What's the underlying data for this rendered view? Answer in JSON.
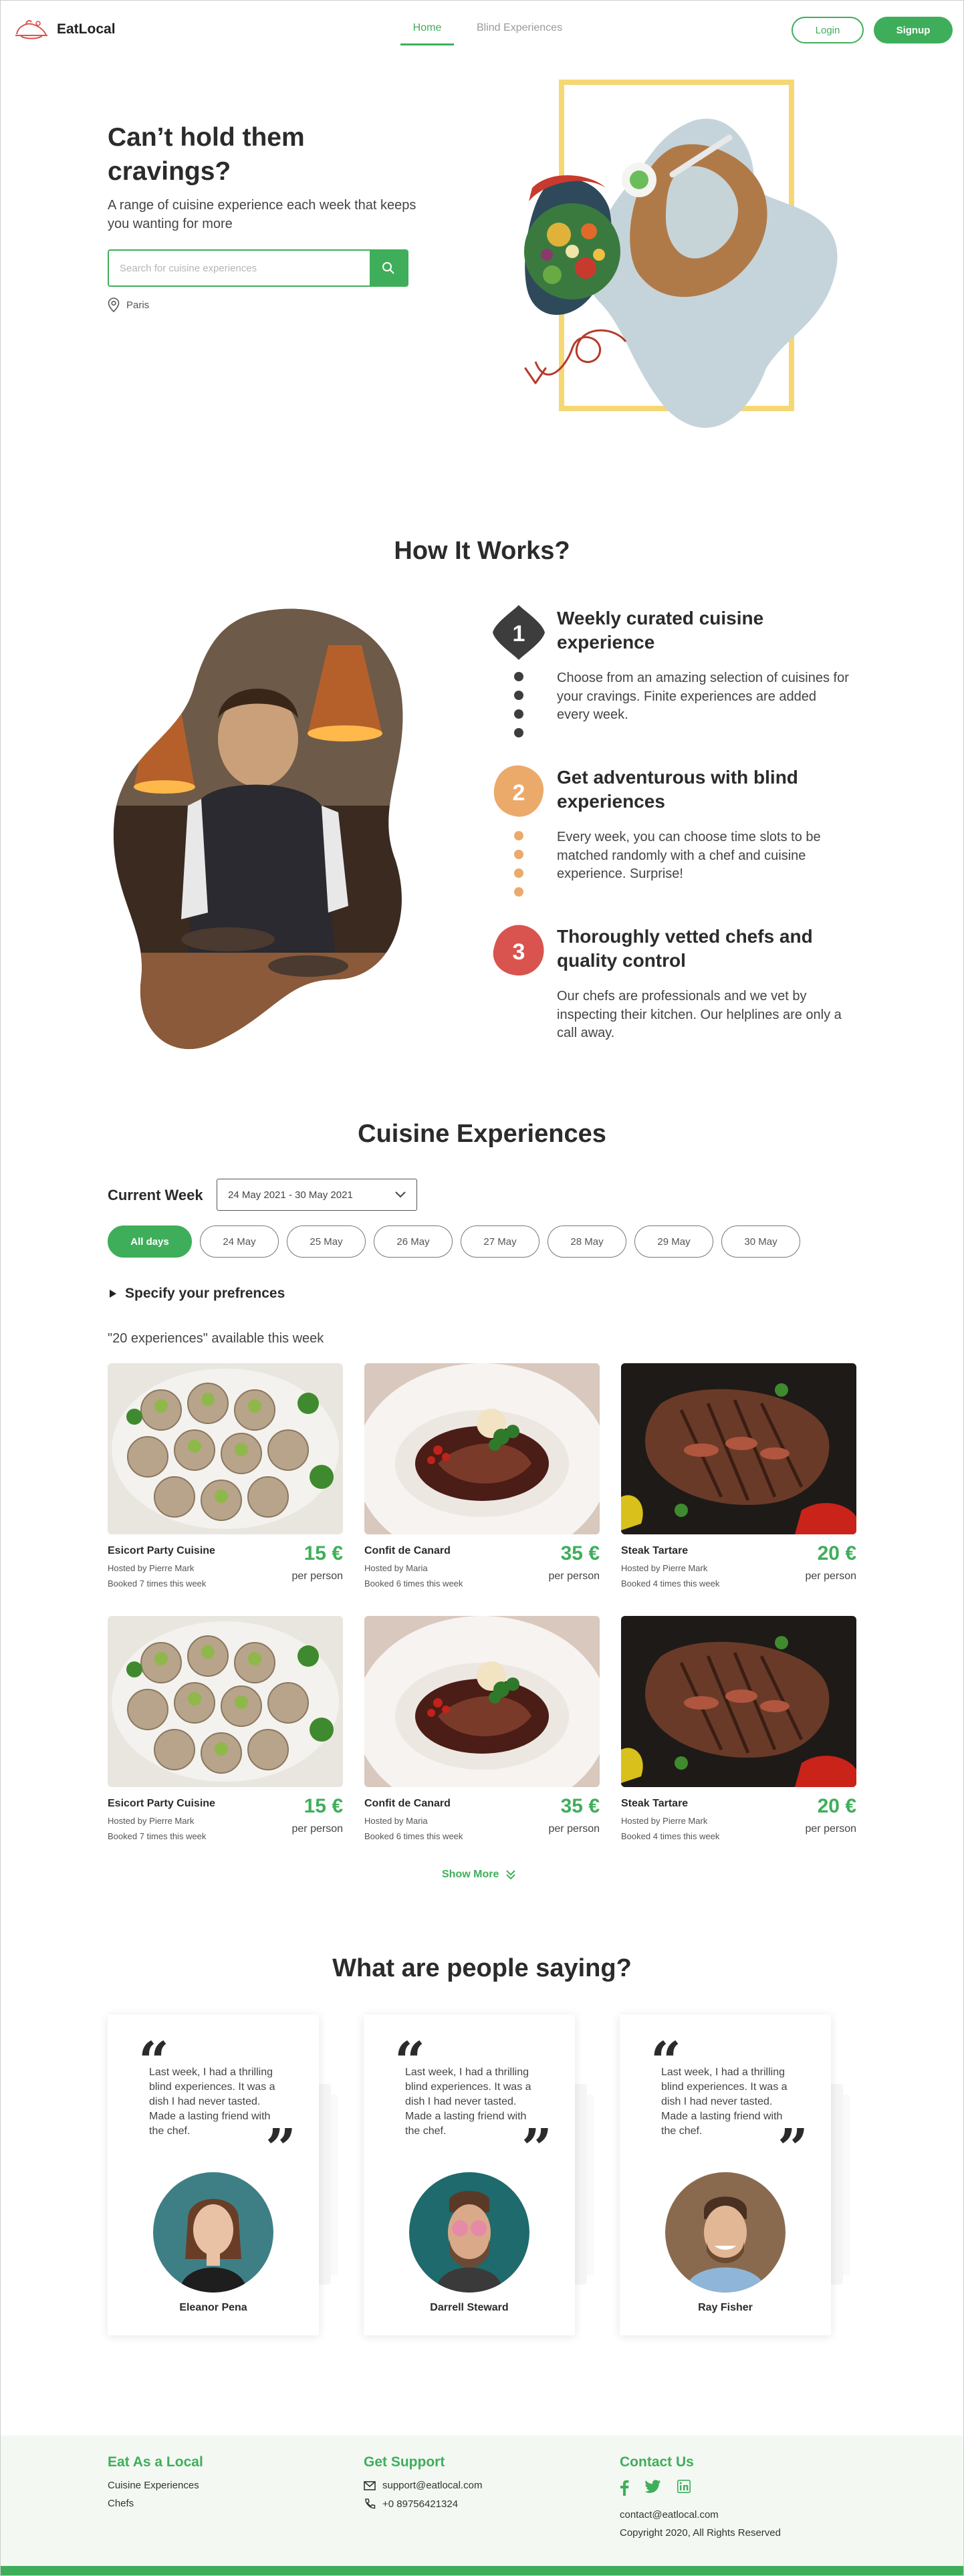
{
  "brand": {
    "name": "EatLocal",
    "accent": "#3fae5a"
  },
  "header": {
    "nav": [
      "Home",
      "Blind Experiences"
    ],
    "login": "Login",
    "signup": "Signup"
  },
  "hero": {
    "title": "Can’t hold them cravings?",
    "subtitle": "A range of cuisine experience each week that keeps you wanting for more",
    "search_placeholder": "Search for cuisine experiences",
    "location": "Paris"
  },
  "how": {
    "title": "How It Works?",
    "steps": [
      {
        "num": "1",
        "title": "Weekly curated cuisine experience",
        "text": "Choose from an amazing selection of cuisines for your cravings. Finite experiences are added every week.",
        "color": "#3d3d3d"
      },
      {
        "num": "2",
        "title": "Get adventurous with blind experiences",
        "text": "Every week, you can choose time slots to be matched randomly with a chef and cuisine experience. Surprise!",
        "color": "#eba96a"
      },
      {
        "num": "3",
        "title": "Thoroughly vetted chefs and quality control",
        "text": "Our chefs are professionals and we vet by inspecting their kitchen. Our helplines are only a call away.",
        "color": "#d9544f"
      }
    ]
  },
  "cuisine": {
    "title": "Cuisine Experiences",
    "week_label": "Current Week",
    "week_value": "24 May 2021 - 30 May 2021",
    "days": [
      "All days",
      "24 May",
      "25 May",
      "26 May",
      "27 May",
      "28 May",
      "29 May",
      "30 May"
    ],
    "pref_label": "Specify your prefrences",
    "available": "\"20 experiences\" available this week",
    "cards": [
      {
        "name": "Esicort Party Cuisine",
        "host": "Hosted by Pierre Mark",
        "booked": "Booked 7 times this week",
        "price": "15 €",
        "per": "per person",
        "image": "escargot"
      },
      {
        "name": "Confit de Canard",
        "host": "Hosted by Maria",
        "booked": "Booked 6 times this week",
        "price": "35 €",
        "per": "per person",
        "image": "duck"
      },
      {
        "name": "Steak Tartare",
        "host": "Hosted by Pierre Mark",
        "booked": "Booked 4 times this week",
        "price": "20 €",
        "per": "per person",
        "image": "steak"
      },
      {
        "name": "Esicort Party Cuisine",
        "host": "Hosted by Pierre Mark",
        "booked": "Booked 7 times this week",
        "price": "15 €",
        "per": "per person",
        "image": "escargot"
      },
      {
        "name": "Confit de Canard",
        "host": "Hosted by Maria",
        "booked": "Booked 6 times this week",
        "price": "35 €",
        "per": "per person",
        "image": "duck"
      },
      {
        "name": "Steak Tartare",
        "host": "Hosted by Pierre Mark",
        "booked": "Booked 4 times this week",
        "price": "20 €",
        "per": "per person",
        "image": "steak"
      }
    ],
    "show_more": "Show More"
  },
  "testimonials": {
    "title": "What are people saying?",
    "items": [
      {
        "text": "Last week, I had a thrilling blind experiences. It was a dish I had never tasted. Made a lasting friend with the chef.",
        "name": "Eleanor Pena"
      },
      {
        "text": "Last week, I had a thrilling blind experiences. It was a dish I had never tasted. Made a lasting friend with the chef.",
        "name": "Darrell Steward"
      },
      {
        "text": "Last week, I had a thrilling blind experiences. It was a dish I had never tasted. Made a lasting friend with the chef.",
        "name": "Ray Fisher"
      }
    ]
  },
  "footer": {
    "col1_title": "Eat As a Local",
    "col1_links": [
      "Cuisine Experiences",
      "Chefs"
    ],
    "col2_title": "Get Support",
    "email": "support@eatlocal.com",
    "phone": "+0 89756421324",
    "col3_title": "Contact Us",
    "socials": [
      "facebook-icon",
      "twitter-icon",
      "linkedin-icon"
    ],
    "contact_email": "contact@eatlocal.com",
    "copyright": "Copyright 2020, All Rights Reserved"
  }
}
